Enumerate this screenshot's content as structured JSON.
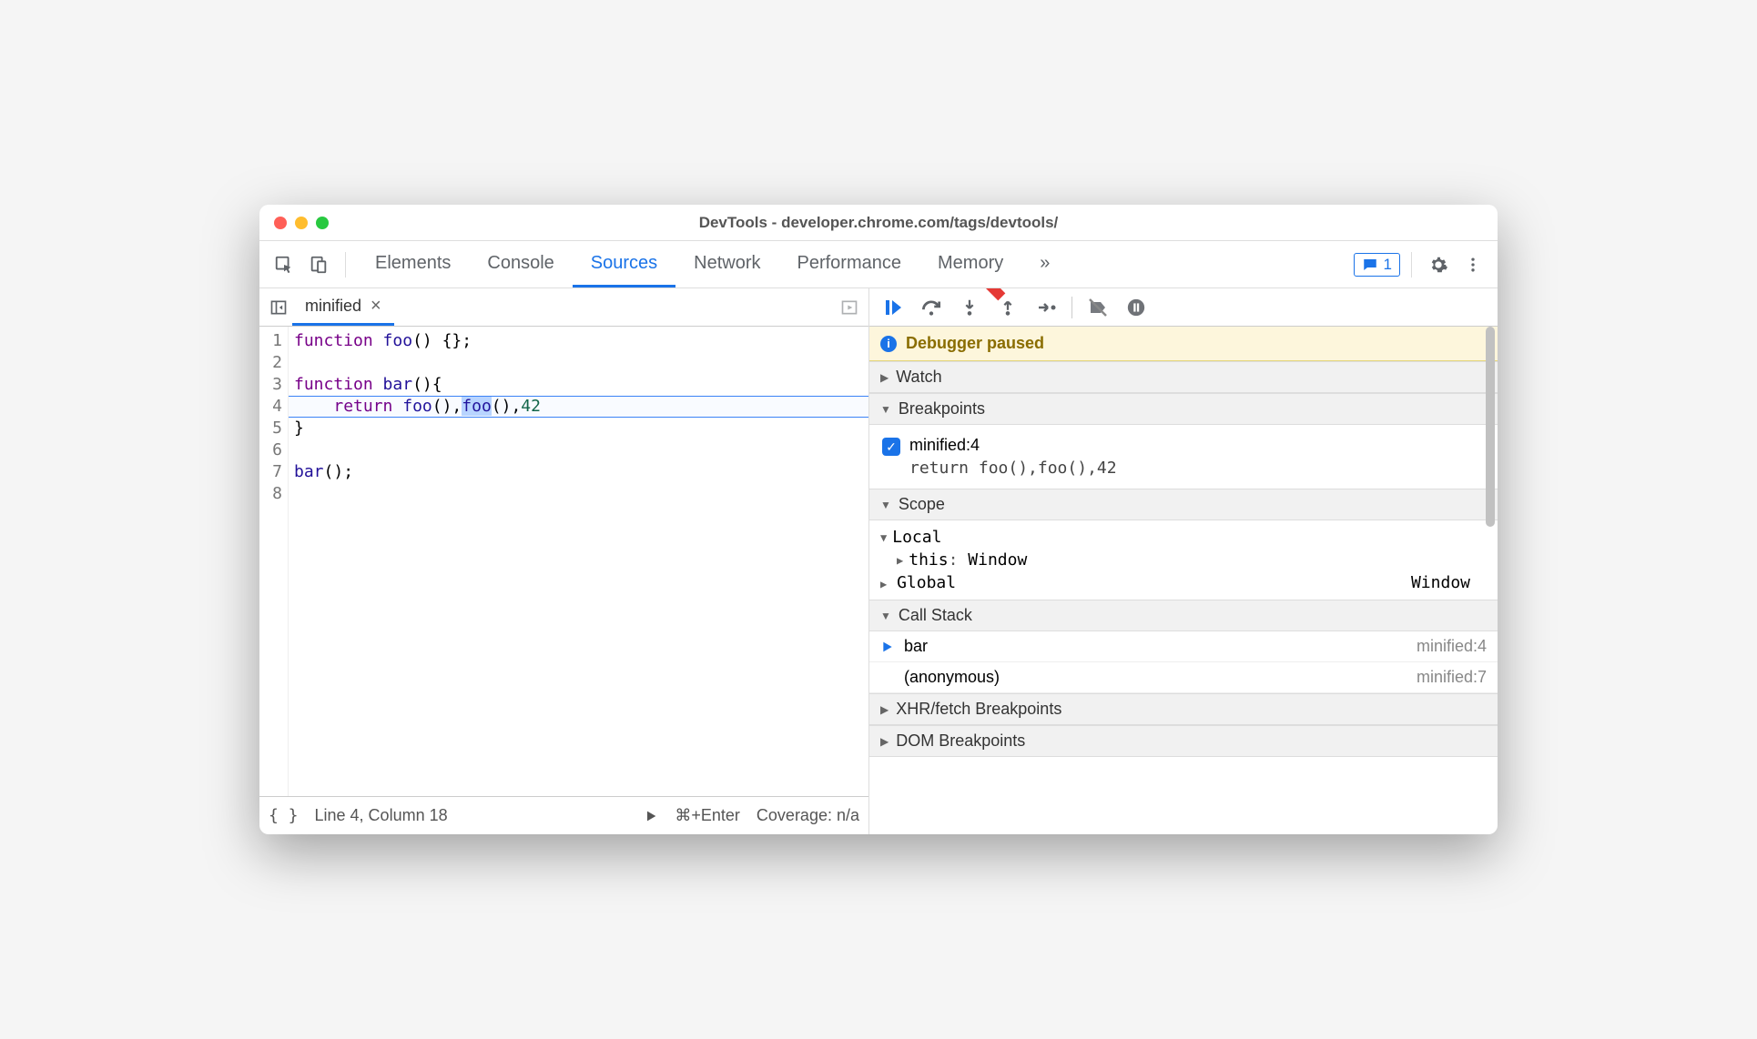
{
  "window": {
    "title": "DevTools - developer.chrome.com/tags/devtools/"
  },
  "toolbar": {
    "tabs": [
      "Elements",
      "Console",
      "Sources",
      "Network",
      "Performance",
      "Memory"
    ],
    "active_tab": "Sources",
    "more_tabs_glyph": "»",
    "feedback_count": "1"
  },
  "file_tab": {
    "name": "minified",
    "close_glyph": "×"
  },
  "code": {
    "lines": [
      {
        "n": 1,
        "html": "<span class='kw'>function</span> <span class='fn'>foo</span>() {};"
      },
      {
        "n": 2,
        "html": ""
      },
      {
        "n": 3,
        "html": "<span class='kw'>function</span> <span class='fn'>bar</span>(){"
      },
      {
        "n": 4,
        "html": "    <span class='kw'>return</span> <span class='fn'>foo</span>(),<span class='sel-token'><span class='fn'>foo</span></span>(),<span class='num'>42</span>"
      },
      {
        "n": 5,
        "html": "}"
      },
      {
        "n": 6,
        "html": ""
      },
      {
        "n": 7,
        "html": "<span class='fn'>bar</span>();"
      },
      {
        "n": 8,
        "html": ""
      }
    ],
    "highlight_line_index": 3
  },
  "statusbar": {
    "pretty_glyph": "{ }",
    "position": "Line 4, Column 18",
    "run_hint": "⌘+Enter",
    "coverage": "Coverage: n/a"
  },
  "debugger": {
    "paused_label": "Debugger paused",
    "sections": {
      "watch": "Watch",
      "breakpoints": "Breakpoints",
      "scope": "Scope",
      "callstack": "Call Stack",
      "xhr": "XHR/fetch Breakpoints",
      "dom": "DOM Breakpoints"
    },
    "breakpoint": {
      "label": "minified:4",
      "snippet": "return foo(),foo(),42"
    },
    "scope": {
      "local_label": "Local",
      "this_label": "this",
      "this_value": "Window",
      "global_label": "Global",
      "global_value": "Window"
    },
    "callstack": [
      {
        "fn": "bar",
        "loc": "minified:4",
        "current": true
      },
      {
        "fn": "(anonymous)",
        "loc": "minified:7",
        "current": false
      }
    ]
  }
}
